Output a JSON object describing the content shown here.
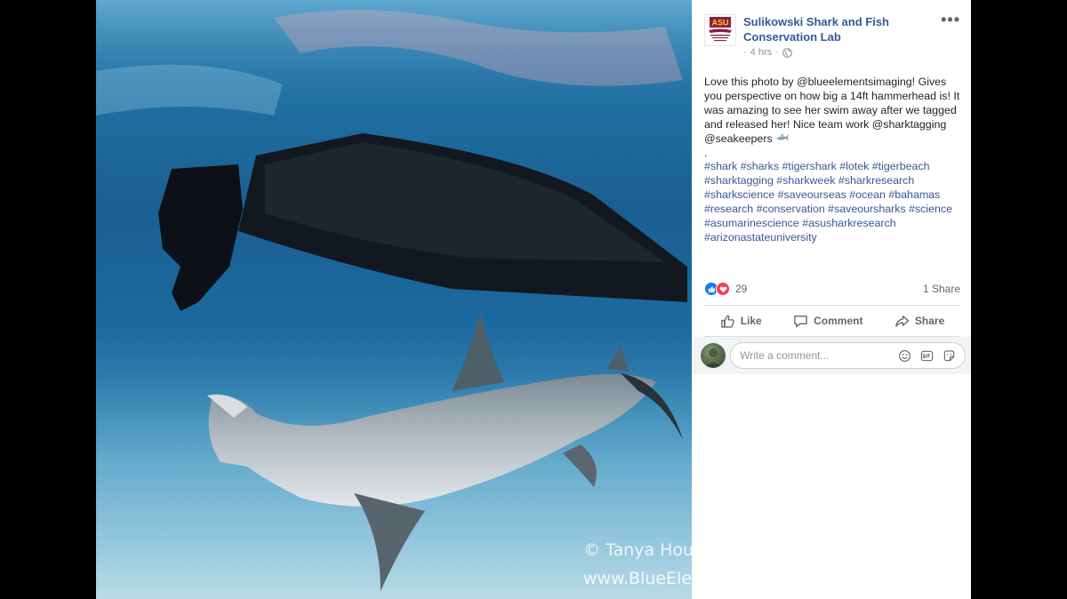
{
  "photo": {
    "watermark_line1": "© Tanya Houpper",
    "watermark_line2": "www.BlueElement"
  },
  "post": {
    "page_name": "Sulikowski Shark and Fish Conservation Lab",
    "logo_text": "ASU",
    "logo_subtext": "Sulikowski Shark and Fish Conservation Lab",
    "timestamp": "4 hrs",
    "timestamp_separator": "·",
    "more_label": "•••",
    "text_p1": "Love this photo by @blueelementsimaging! Gives you perspective on how big a 14ft hammerhead is! It was amazing to see her swim away after we tagged and released her! Nice team work @sharktagging @seakeepers",
    "text_dot": ".",
    "hashtags": [
      "#shark",
      "#sharks",
      "#tigershark",
      "#lotek",
      "#tigerbeach",
      "#sharktagging",
      "#sharkweek",
      "#sharkresearch",
      "#sharkscience",
      "#saveourseas",
      "#ocean",
      "#bahamas",
      "#research",
      "#conservation",
      "#saveoursharks",
      "#science",
      "#asumarinescience",
      "#asusharkresearch",
      "#arizonastateuniversity"
    ]
  },
  "reactions": {
    "count": "29",
    "shares": "1 Share"
  },
  "actions": {
    "like": "Like",
    "comment": "Comment",
    "share": "Share"
  },
  "comment_box": {
    "placeholder": "Write a comment..."
  },
  "icons": {
    "globe": "globe-icon",
    "like": "thumbs-up-icon",
    "comment": "speech-bubble-icon",
    "share": "share-arrow-icon",
    "emoji": "smiley-icon",
    "gif": "gif-icon",
    "sticker": "sticker-icon",
    "shark": "shark-emoji-icon"
  },
  "colors": {
    "link": "#385898",
    "like_reaction": "#1877f2",
    "love_reaction": "#f33e58",
    "asu_maroon": "#8c1d40"
  }
}
